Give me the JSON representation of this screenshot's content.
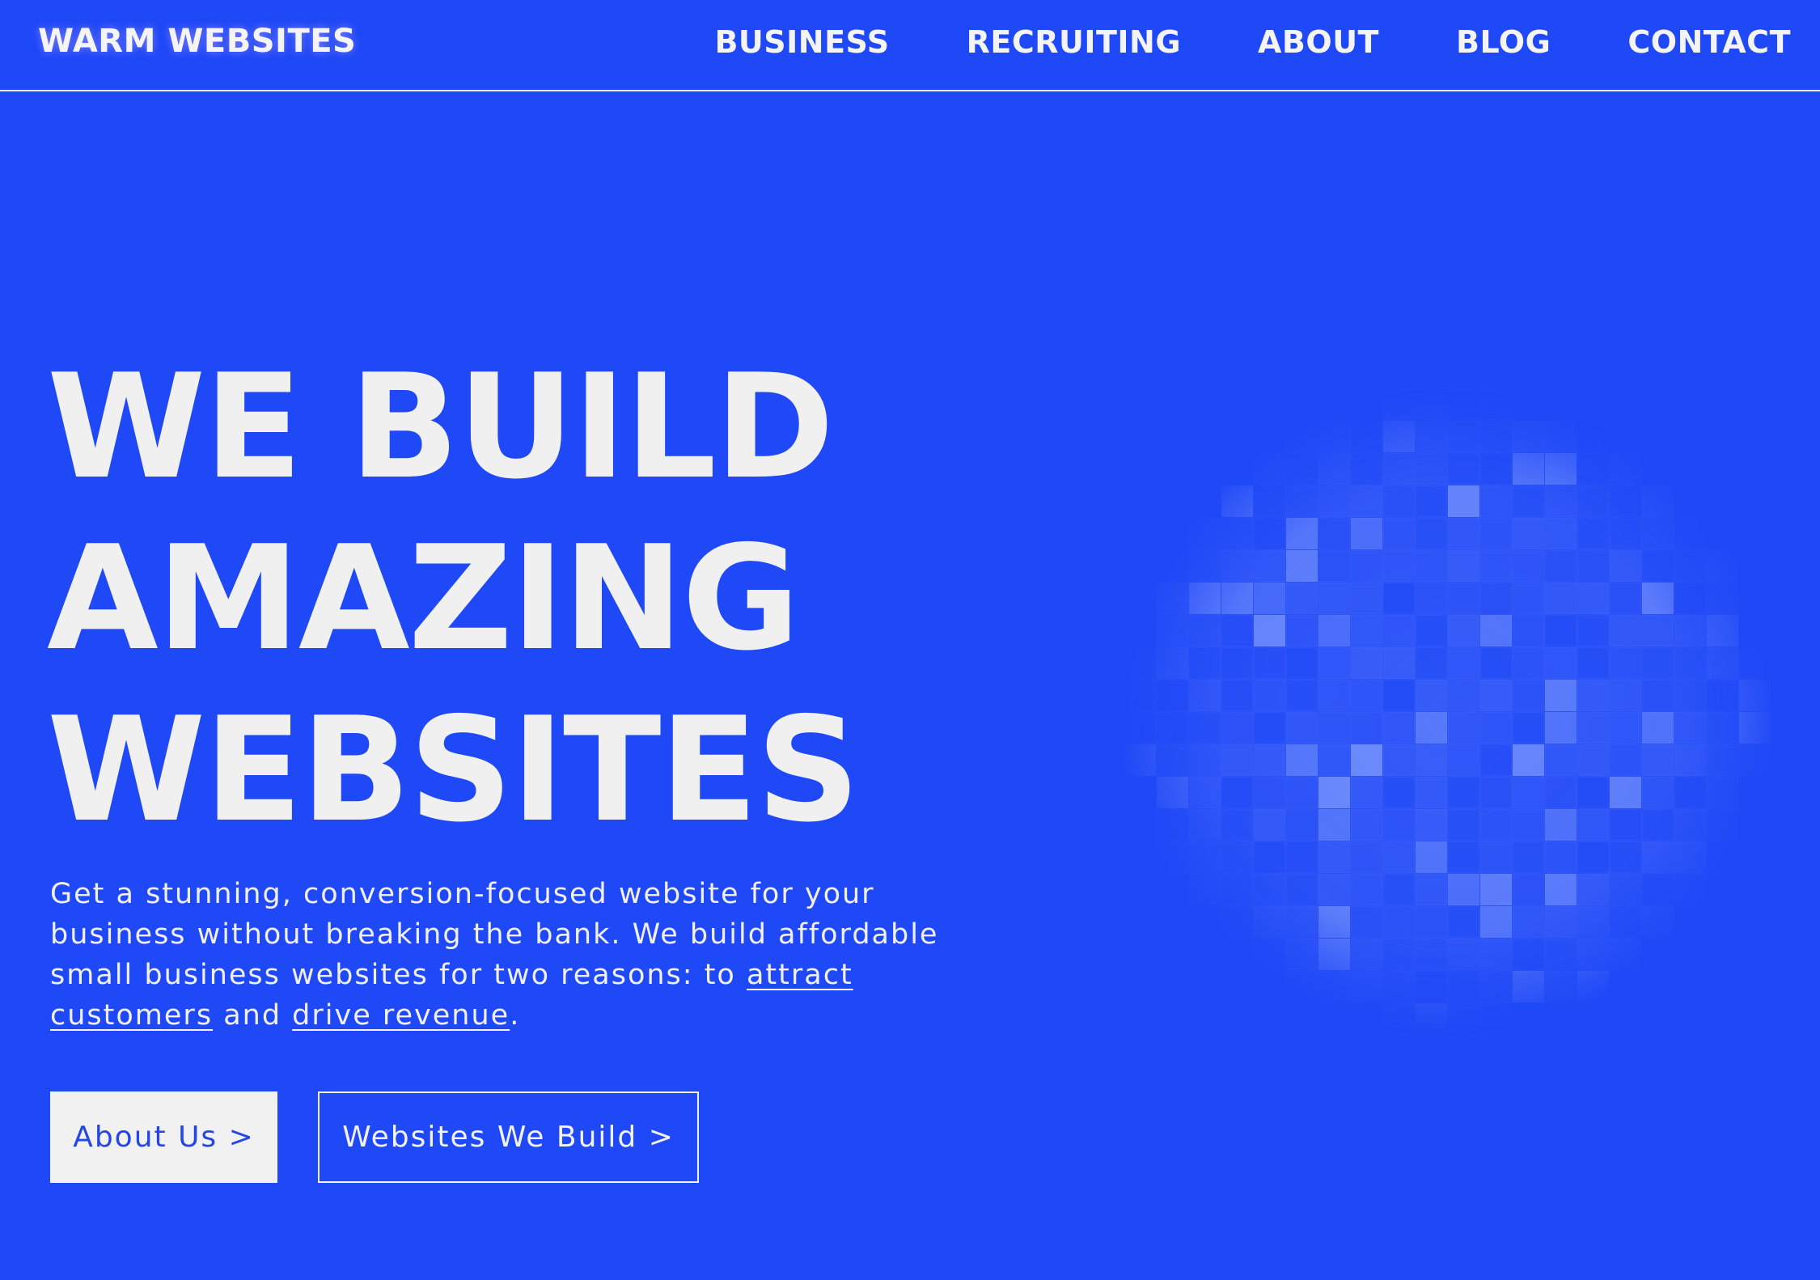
{
  "header": {
    "logo": "WARM WEBSITES",
    "nav": [
      "BUSINESS",
      "RECRUITING",
      "ABOUT",
      "BLOG",
      "CONTACT"
    ]
  },
  "hero": {
    "headline_lines": [
      "WE BUILD",
      "AMAZING",
      "WEBSITES"
    ],
    "description": {
      "part1": "Get a stunning, conversion-focused website for your business without breaking the bank. We build affordable small business websites for two reasons: to ",
      "link1": "attract customers",
      "part2": " and ",
      "link2": "drive revenue",
      "part3": "."
    },
    "buttons": {
      "primary": "About Us >",
      "secondary": "Websites We Build >"
    },
    "graphic": "pixel-globe-icon"
  },
  "colors": {
    "background": "#1f48f7",
    "text": "#f1f1f1",
    "button_text": "#2546e6"
  }
}
